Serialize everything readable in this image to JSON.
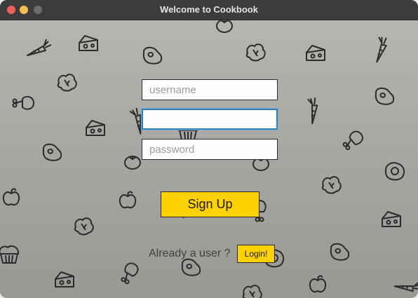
{
  "window": {
    "title": "Welcome to Cookbook"
  },
  "form": {
    "username_placeholder": "username",
    "second_value": "",
    "password_placeholder": "password",
    "signup_label": "Sign Up",
    "already_text": "Already a user ?",
    "login_label": "Login!"
  },
  "colors": {
    "accent": "#fdd200",
    "focus_ring": "#2f7fb7"
  },
  "background_icons": [
    "carrot-icon",
    "cheese-icon",
    "steak-icon",
    "lettuce-icon",
    "chicken-leg-icon",
    "apple-icon",
    "muffin-icon",
    "fried-egg-icon",
    "tomato-icon"
  ]
}
